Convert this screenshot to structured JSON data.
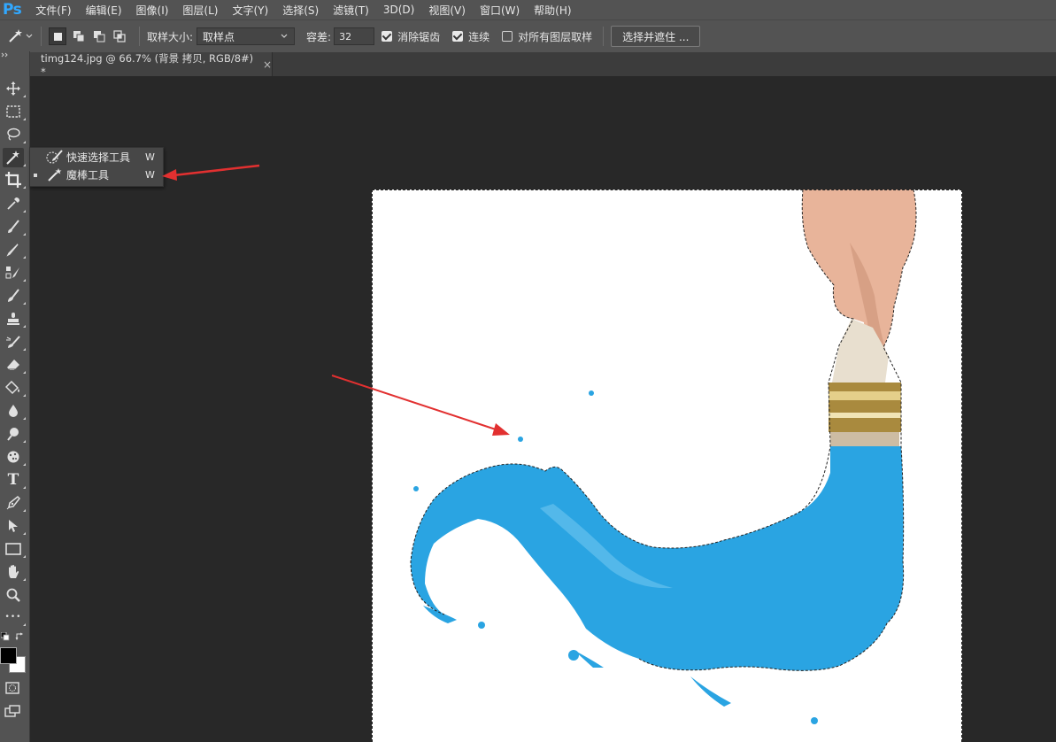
{
  "app": {
    "logo": "Ps"
  },
  "menu": [
    "文件(F)",
    "编辑(E)",
    "图像(I)",
    "图层(L)",
    "文字(Y)",
    "选择(S)",
    "滤镜(T)",
    "3D(D)",
    "视图(V)",
    "窗口(W)",
    "帮助(H)"
  ],
  "options": {
    "sample_size_label": "取样大小:",
    "sample_size_value": "取样点",
    "tolerance_label": "容差:",
    "tolerance_value": "32",
    "antialias_label": "消除锯齿",
    "antialias_checked": true,
    "contiguous_label": "连续",
    "contiguous_checked": true,
    "all_layers_label": "对所有图层取样",
    "all_layers_checked": false,
    "select_mask_button": "选择并遮住 ..."
  },
  "document": {
    "tab_title": "timg124.jpg @ 66.7% (背景 拷贝, RGB/8#) *",
    "close_symbol": "×"
  },
  "flyout": {
    "items": [
      {
        "label": "快速选择工具",
        "shortcut": "W",
        "icon": "quick-selection-icon"
      },
      {
        "label": "魔棒工具",
        "shortcut": "W",
        "icon": "magic-wand-icon",
        "active": true
      }
    ]
  },
  "colors": {
    "accent_arrow": "#e23030",
    "paint_blue": "#2aa4e2",
    "ps_blue": "#31a8ff"
  },
  "toolbox": {
    "tools": [
      "move-icon",
      "marquee-icon",
      "lasso-icon",
      "magic-wand-icon",
      "crop-icon",
      "eyedropper-icon",
      "healing-brush-icon",
      "brush-icon",
      "clone-stamp-icon",
      "history-brush-icon",
      "eraser-icon",
      "gradient-icon",
      "blur-icon",
      "dodge-icon",
      "sponge-icon",
      "type-icon",
      "pen-icon",
      "path-selection-icon",
      "rectangle-icon",
      "hand-icon",
      "zoom-icon",
      "more-icon"
    ],
    "type_glyph": "T",
    "more_glyph": "•••"
  }
}
